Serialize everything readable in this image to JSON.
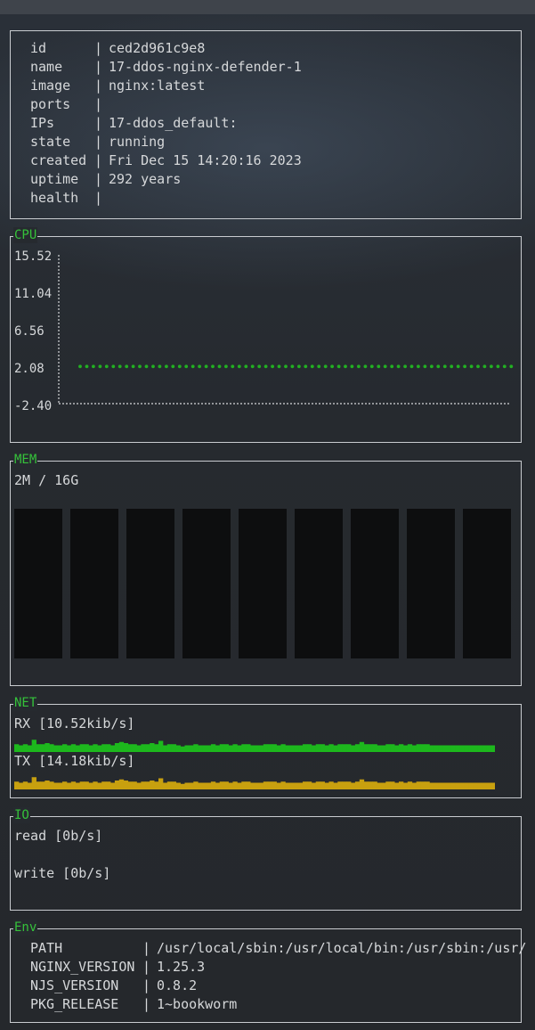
{
  "info": {
    "rows": [
      {
        "key": "id",
        "value": "ced2d961c9e8"
      },
      {
        "key": "name",
        "value": "17-ddos-nginx-defender-1"
      },
      {
        "key": "image",
        "value": "nginx:latest"
      },
      {
        "key": "ports",
        "value": ""
      },
      {
        "key": "IPs",
        "value": "17-ddos_default:"
      },
      {
        "key": "state",
        "value": "running"
      },
      {
        "key": "created",
        "value": "Fri Dec 15 14:20:16 2023"
      },
      {
        "key": "uptime",
        "value": "292 years"
      },
      {
        "key": "health",
        "value": ""
      }
    ],
    "separator": "|"
  },
  "cpu": {
    "title": "CPU",
    "y_ticks": [
      "15.52",
      "11.04",
      "6.56",
      "2.08",
      "-2.40"
    ]
  },
  "mem": {
    "title": "MEM",
    "usage": "2M / 16G",
    "bar_count": 9
  },
  "net": {
    "title": "NET",
    "rx_label": "RX [10.52kib/s]",
    "tx_label": "TX [14.18kib/s]",
    "rx_color": "#1db81d",
    "tx_color": "#c8a00f"
  },
  "io": {
    "title": "IO",
    "read_label": "read [0b/s]",
    "write_label": "write [0b/s]"
  },
  "env": {
    "title": "Env",
    "rows": [
      {
        "key": "PATH",
        "value": "/usr/local/sbin:/usr/local/bin:/usr/sbin:/usr/"
      },
      {
        "key": "NGINX_VERSION",
        "value": "1.25.3"
      },
      {
        "key": "NJS_VERSION",
        "value": "0.8.2"
      },
      {
        "key": "PKG_RELEASE",
        "value": "1~bookworm"
      }
    ]
  },
  "chart_data": {
    "type": "scatter",
    "title": "CPU",
    "ylim": [
      -2.4,
      15.52
    ],
    "y_ticks": [
      15.52,
      11.04,
      6.56,
      2.08,
      -2.4
    ],
    "series": [
      {
        "values": [
          2.08,
          2.08,
          2.08,
          2.08,
          2.08,
          2.08,
          2.08,
          2.08,
          2.08,
          2.08,
          2.08,
          2.08,
          2.08,
          2.08,
          2.08,
          2.08,
          2.08,
          2.08,
          2.08,
          2.08,
          2.08,
          2.08,
          2.08,
          2.08,
          2.08,
          2.08,
          2.08,
          2.08,
          2.08,
          2.08,
          2.08,
          2.08,
          2.08,
          2.08,
          2.08,
          2.08,
          2.08,
          2.08,
          2.08,
          2.08,
          2.08,
          2.08,
          2.08,
          2.08,
          2.08,
          2.08,
          2.08,
          2.08,
          2.08,
          2.08,
          2.08,
          2.08,
          2.08,
          2.08,
          2.08,
          2.08,
          2.08,
          2.08,
          2.08,
          2.08,
          2.08,
          2.08,
          2.08,
          2.08,
          2.08,
          2.08
        ]
      }
    ],
    "color": "#22b022",
    "grid": false
  }
}
